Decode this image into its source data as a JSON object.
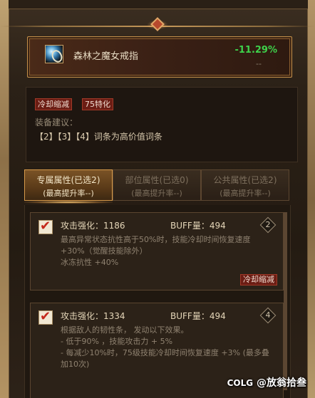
{
  "item": {
    "name": "森林之魔女戒指",
    "icon": "ring-icon",
    "delta": "-11.29%",
    "delta_sub": "--",
    "delta_color": "#3ed24b"
  },
  "tags": [
    "冷却缩减",
    "75特化"
  ],
  "suggestion": {
    "label": "装备建议：",
    "text": "【2】【3】【4】词条为高价值词条"
  },
  "tabs": [
    {
      "title": "专属属性(已选2)",
      "sub": "(最高提升率--)",
      "active": true
    },
    {
      "title": "部位属性(已选0)",
      "sub": "(最高提升率--)",
      "active": false
    },
    {
      "title": "公共属性(已选2)",
      "sub": "(最高提升率--)",
      "active": false
    }
  ],
  "cards": [
    {
      "checked": true,
      "title": "攻击强化：1186",
      "buff": "BUFF量：494",
      "badge": "2",
      "lines": [
        "最高异常状态抗性高于50%时，技能冷却时间恢复速度",
        "+30%（觉醒技能除外）",
        "冰冻抗性 +40%"
      ],
      "tag": "冷却缩减"
    },
    {
      "checked": true,
      "title": "攻击强化：1334",
      "buff": "BUFF量：494",
      "badge": "4",
      "lines": [
        "根据敌人的韧性条，  发动以下效果。",
        "- 低于90%  ，技能攻击力 + 5%",
        "- 每减少10%时，75级技能冷却时间恢复速度 +3% (最多叠",
        "加10次)"
      ],
      "tag": ""
    }
  ],
  "watermark": {
    "brand": "COLG",
    "author": "@放翁拾叁"
  }
}
